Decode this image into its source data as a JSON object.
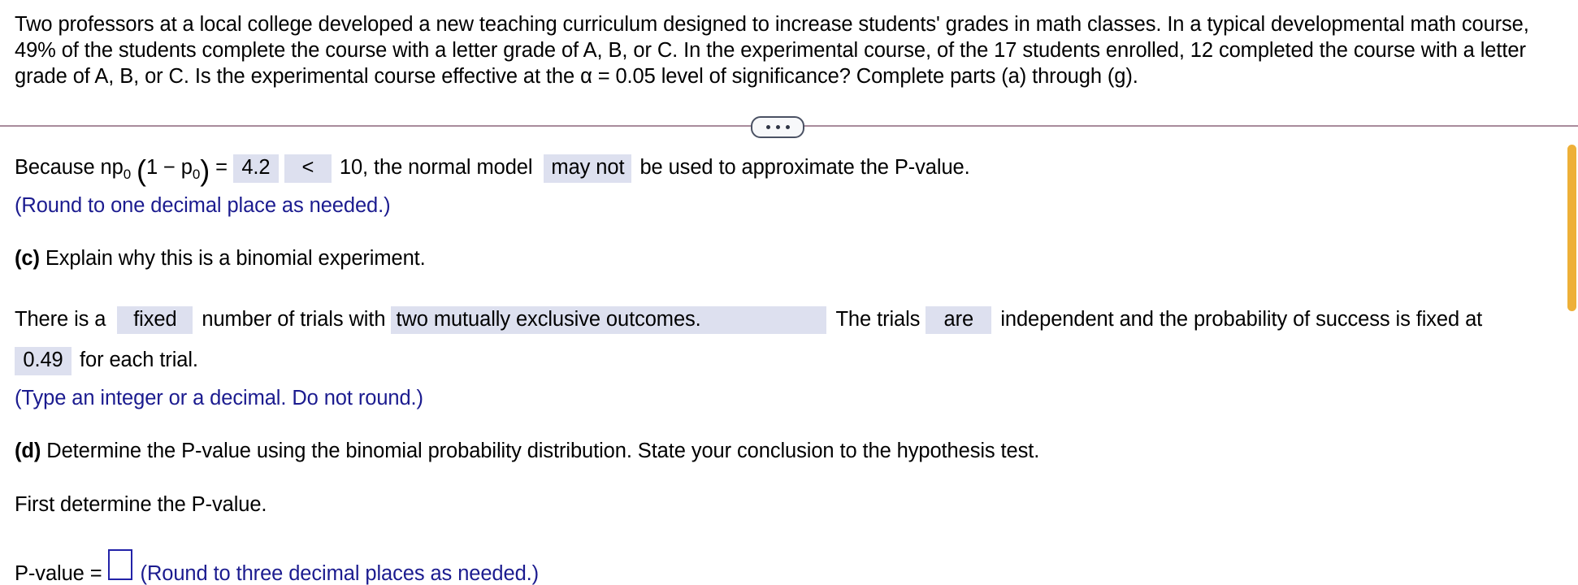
{
  "problem": {
    "statement": "Two professors at a local college developed a new teaching curriculum designed to increase students' grades in math classes. In a typical developmental math course, 49% of the students complete the course with a letter grade of A, B, or C. In the experimental course, of the 17 students enrolled, 12 completed the course with a letter grade of A, B, or C. Is the experimental course effective at the α = 0.05 level of significance? Complete parts (a) through (g)."
  },
  "divider": {
    "expand_label": "•••"
  },
  "part_b": {
    "prefix": "Because np",
    "sub0_a": "0",
    "paren_open": "(",
    "one_minus": "1 − p",
    "sub0_b": "0",
    "paren_close": ")",
    "equals": " = ",
    "value": "4.2",
    "comparison": "<",
    "after_comparison": "10, the normal model",
    "modal": "may not",
    "tail": "be used to approximate the P-value.",
    "hint": "(Round to one decimal place as needed.)"
  },
  "part_c": {
    "label": "(c)",
    "prompt": "Explain why this is a binomial experiment.",
    "sentence_1": "There is a",
    "answer_fixed": "fixed",
    "sentence_2": "number of trials with",
    "answer_outcomes": "two mutually exclusive outcomes.",
    "sentence_3": "The trials",
    "answer_are": "are",
    "sentence_4": "independent and the probability of success is fixed at",
    "answer_probability": "0.49",
    "sentence_5": "for each trial.",
    "hint": "(Type an integer or a decimal. Do not round.)"
  },
  "part_d": {
    "label": "(d)",
    "prompt": "Determine the P-value using the binomial probability distribution. State your conclusion to the hypothesis test.",
    "instruction": "First determine the P-value.",
    "pvalue_label": "P-value =",
    "pvalue_input": "",
    "hint": "(Round to three decimal places as needed.)"
  },
  "colors": {
    "field_highlight": "#dde0ef",
    "hint_blue": "#1b1b8f",
    "divider": "#a98b9c",
    "scrollbar": "#eeb038",
    "input_border": "#2222a8"
  }
}
